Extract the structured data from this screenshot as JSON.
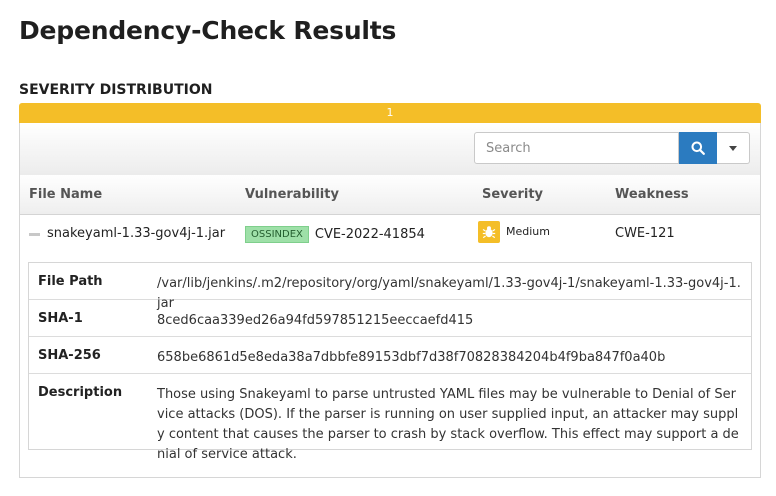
{
  "page": {
    "title": "Dependency-Check Results"
  },
  "severity": {
    "heading": "SEVERITY DISTRIBUTION",
    "bar_count": "1",
    "bar_color": "#f4be28"
  },
  "toolbar": {
    "search_placeholder": "Search",
    "search_icon": "search-icon",
    "dropdown_icon": "caret-down-icon"
  },
  "table": {
    "headers": [
      "File Name",
      "Vulnerability",
      "Severity",
      "Weakness"
    ],
    "rows": [
      {
        "file_name": "snakeyaml-1.33-gov4j-1.jar",
        "source_badge": "OSSINDEX",
        "vulnerability": "CVE-2022-41854",
        "severity": "Medium",
        "severity_color": "#f4be28",
        "weakness": "CWE-121"
      }
    ]
  },
  "details": {
    "file_path_label": "File Path",
    "file_path": "/var/lib/jenkins/.m2/repository/org/yaml/snakeyaml/1.33-gov4j-1/snakeyaml-1.33-gov4j-1.jar",
    "sha1_label": "SHA-1",
    "sha1": "8ced6caa339ed26a94fd597851215eeccaefd415",
    "sha256_label": "SHA-256",
    "sha256": "658be6861d5e8eda38a7dbbfe89153dbf7d38f70828384204b4f9ba847f0a40b",
    "description_label": "Description",
    "description": "Those using Snakeyaml to parse untrusted YAML files may be vulnerable to Denial of Service attacks (DOS). If the parser is running on user supplied input, an attacker may supply content that causes the parser to crash by stack overflow. This effect may support a denial of service attack."
  }
}
